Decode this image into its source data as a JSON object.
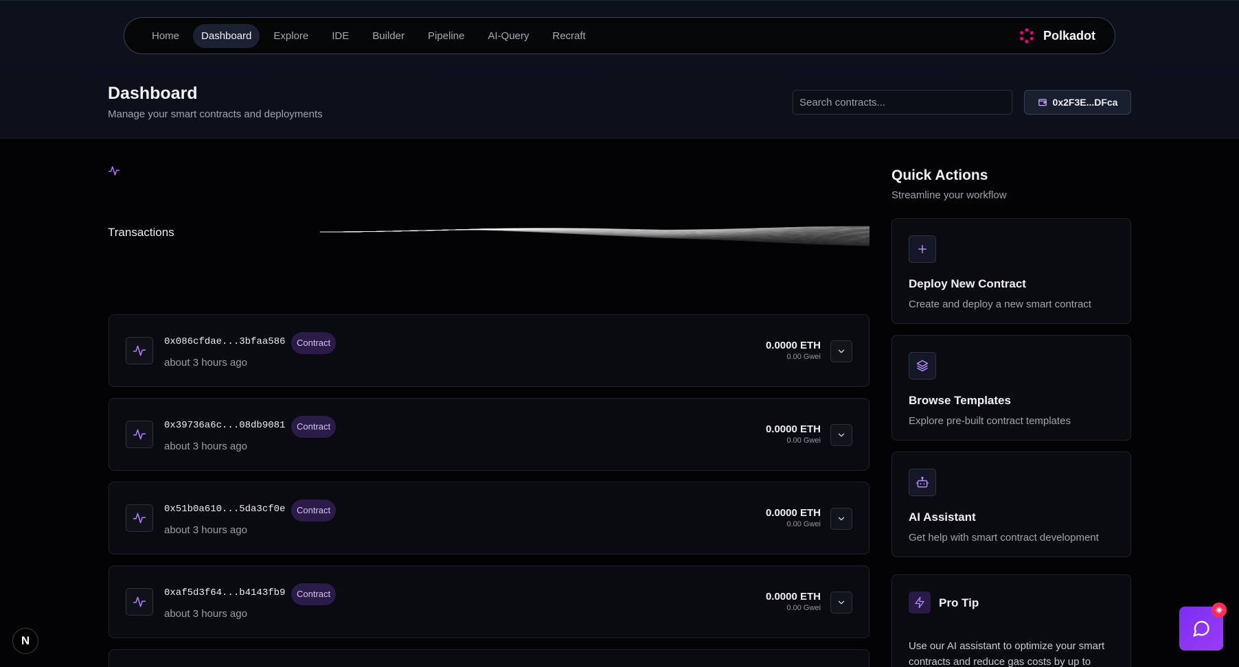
{
  "nav": {
    "items": [
      {
        "label": "Home",
        "active": false
      },
      {
        "label": "Dashboard",
        "active": true
      },
      {
        "label": "Explore",
        "active": false
      },
      {
        "label": "IDE",
        "active": false
      },
      {
        "label": "Builder",
        "active": false
      },
      {
        "label": "Pipeline",
        "active": false
      },
      {
        "label": "AI-Query",
        "active": false
      },
      {
        "label": "Recraft",
        "active": false
      }
    ],
    "brand": "Polkadot",
    "brand_color": "#e6007a"
  },
  "header": {
    "title": "Dashboard",
    "subtitle": "Manage your smart contracts and deployments",
    "search_placeholder": "Search contracts...",
    "wallet_label": "0x2F3E...DFca"
  },
  "transactions": {
    "heading": "Transactions",
    "items": [
      {
        "hash": "0x086cfdae...3bfaa586",
        "badge": "Contract",
        "time": "about 3 hours ago",
        "eth": "0.0000 ETH",
        "gwei": "0.00 Gwei"
      },
      {
        "hash": "0x39736a6c...08db9081",
        "badge": "Contract",
        "time": "about 3 hours ago",
        "eth": "0.0000 ETH",
        "gwei": "0.00 Gwei"
      },
      {
        "hash": "0x51b0a610...5da3cf0e",
        "badge": "Contract",
        "time": "about 3 hours ago",
        "eth": "0.0000 ETH",
        "gwei": "0.00 Gwei"
      },
      {
        "hash": "0xaf5d3f64...b4143fb9",
        "badge": "Contract",
        "time": "about 3 hours ago",
        "eth": "0.0000 ETH",
        "gwei": "0.00 Gwei"
      }
    ]
  },
  "quick_actions": {
    "title": "Quick Actions",
    "subtitle": "Streamline your workflow",
    "items": [
      {
        "icon": "plus-icon",
        "name": "Deploy New Contract",
        "desc": "Create and deploy a new smart contract"
      },
      {
        "icon": "layers-icon",
        "name": "Browse Templates",
        "desc": "Explore pre-built contract templates"
      },
      {
        "icon": "robot-icon",
        "name": "AI Assistant",
        "desc": "Get help with smart contract development"
      }
    ]
  },
  "pro_tip": {
    "title": "Pro Tip",
    "text": "Use our AI assistant to optimize your smart contracts and reduce gas costs by up to"
  },
  "floating": {
    "next_label": "N"
  },
  "colors": {
    "accent": "#9b5cf6",
    "badge_bg": "#2b1b48",
    "chat_bg": "#8b35f3",
    "notification": "#ff2d55"
  }
}
